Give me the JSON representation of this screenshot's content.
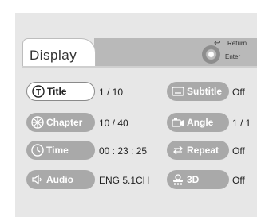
{
  "tab": {
    "label": "Display"
  },
  "nav": {
    "return_label": "Return",
    "enter_label": "Enter"
  },
  "left_items": [
    {
      "label": "Title",
      "value": "1  /  10",
      "icon": "title-icon"
    },
    {
      "label": "Chapter",
      "value": "10  /  40",
      "icon": "chapter-icon"
    },
    {
      "label": "Time",
      "value": "00 : 23 : 25",
      "icon": "time-icon"
    },
    {
      "label": "Audio",
      "value": "ENG 5.1CH",
      "icon": "audio-icon"
    }
  ],
  "right_items": [
    {
      "label": "Subtitle",
      "value": "Off",
      "icon": "subtitle-icon"
    },
    {
      "label": "Angle",
      "value": "1 / 1",
      "icon": "angle-icon"
    },
    {
      "label": "Repeat",
      "value": "Off",
      "icon": "repeat-icon"
    },
    {
      "label": "3D",
      "value": "Off",
      "icon": "3d-icon"
    }
  ]
}
